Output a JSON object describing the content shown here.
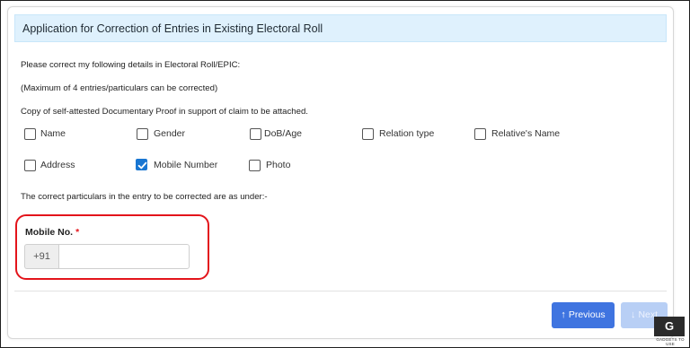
{
  "header": {
    "title": "Application for Correction of Entries in Existing Electoral Roll"
  },
  "intro": {
    "line1": "Please correct my following details in Electoral Roll/EPIC:",
    "line2": "(Maximum of 4 entries/particulars can be corrected)",
    "line3": "Copy of self-attested Documentary Proof in support of claim to be attached."
  },
  "checkboxes": [
    {
      "label": "Name",
      "checked": false
    },
    {
      "label": "Gender",
      "checked": false
    },
    {
      "label": "DoB/Age",
      "checked": false
    },
    {
      "label": "Relation type",
      "checked": false
    },
    {
      "label": "Relative's Name",
      "checked": false
    },
    {
      "label": "Address",
      "checked": false
    },
    {
      "label": "Mobile Number",
      "checked": true
    },
    {
      "label": "Photo",
      "checked": false
    }
  ],
  "particulars_text": "The correct particulars in the entry to be corrected are as under:-",
  "mobile": {
    "label": "Mobile No.",
    "required_marker": "*",
    "prefix": "+91",
    "value": ""
  },
  "buttons": {
    "previous": "Previous",
    "next": "Next"
  },
  "watermark": {
    "logo_text": "G",
    "caption": "GADGETS TO USE"
  },
  "colors": {
    "accent": "#3f74e0",
    "header_bg": "#dff1fd",
    "highlight": "#e3141b",
    "checkbox_checked": "#1976d2"
  }
}
